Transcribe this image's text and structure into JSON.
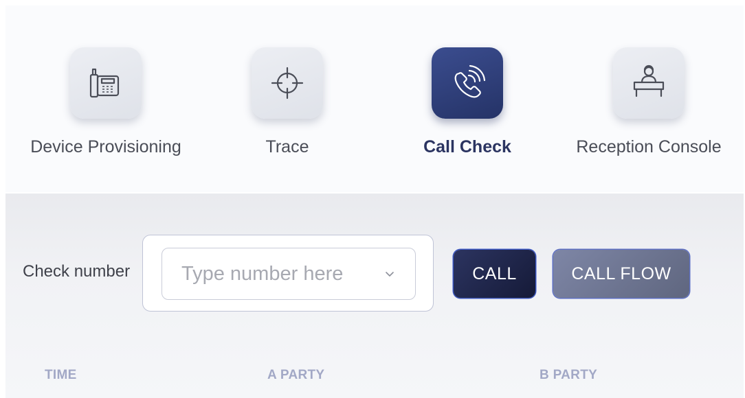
{
  "tools": [
    {
      "label": "Device Provisioning",
      "icon": "desk-phone-icon"
    },
    {
      "label": "Trace",
      "icon": "crosshair-icon"
    },
    {
      "label": "Call Check",
      "icon": "phone-call-icon",
      "active": true
    },
    {
      "label": "Reception Console",
      "icon": "receptionist-desk-icon"
    }
  ],
  "check": {
    "label": "Check number",
    "placeholder": "Type number here"
  },
  "buttons": {
    "call": "CALL",
    "call_flow": "CALL FLOW"
  },
  "table": {
    "columns": [
      "TIME",
      "A PARTY",
      "B PARTY"
    ]
  },
  "colors": {
    "accent": "#2b3461",
    "active_tile": "#2f3f7c",
    "call_button": "#1d2347",
    "call_flow_button": "#6e7592",
    "column_header": "#a2a8c6"
  }
}
